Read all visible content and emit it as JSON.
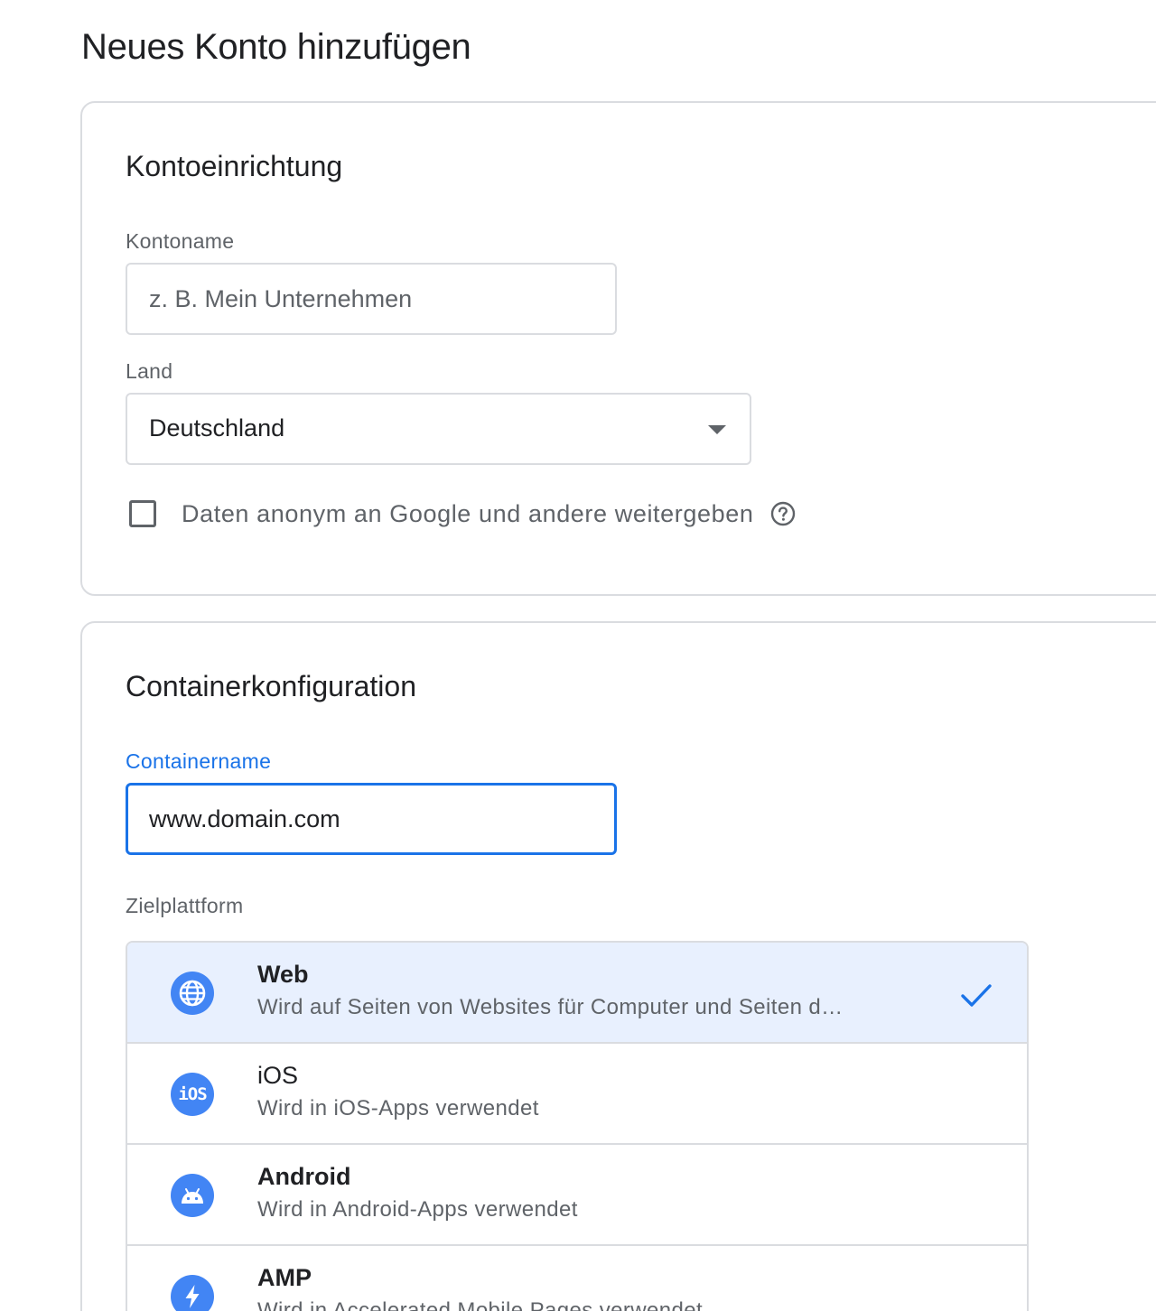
{
  "page": {
    "title": "Neues Konto hinzufügen"
  },
  "account_setup": {
    "title": "Kontoeinrichtung",
    "account_name_label": "Kontoname",
    "account_name_placeholder": "z. B. Mein Unternehmen",
    "account_name_value": "",
    "country_label": "Land",
    "country_value": "Deutschland",
    "share_data_label": "Daten anonym an Google und andere weitergeben",
    "share_data_checked": false
  },
  "container_setup": {
    "title": "Containerkonfiguration",
    "container_name_label": "Containername",
    "container_name_value": "www.domain.com",
    "target_platform_label": "Zielplattform",
    "platforms": [
      {
        "name": "Web",
        "description": "Wird auf Seiten von Websites für Computer und Seiten d…",
        "icon": "globe-icon",
        "selected": true
      },
      {
        "name": "iOS",
        "description": "Wird in iOS-Apps verwendet",
        "icon": "ios-icon",
        "selected": false
      },
      {
        "name": "Android",
        "description": "Wird in Android-Apps verwendet",
        "icon": "android-icon",
        "selected": false
      },
      {
        "name": "AMP",
        "description": "Wird in Accelerated Mobile Pages verwendet",
        "icon": "lightning-icon",
        "selected": false
      }
    ]
  },
  "colors": {
    "accent": "#1a73e8",
    "icon_blue": "#4285f4",
    "selected_bg": "#e8f0fe",
    "border": "#dadce0"
  }
}
